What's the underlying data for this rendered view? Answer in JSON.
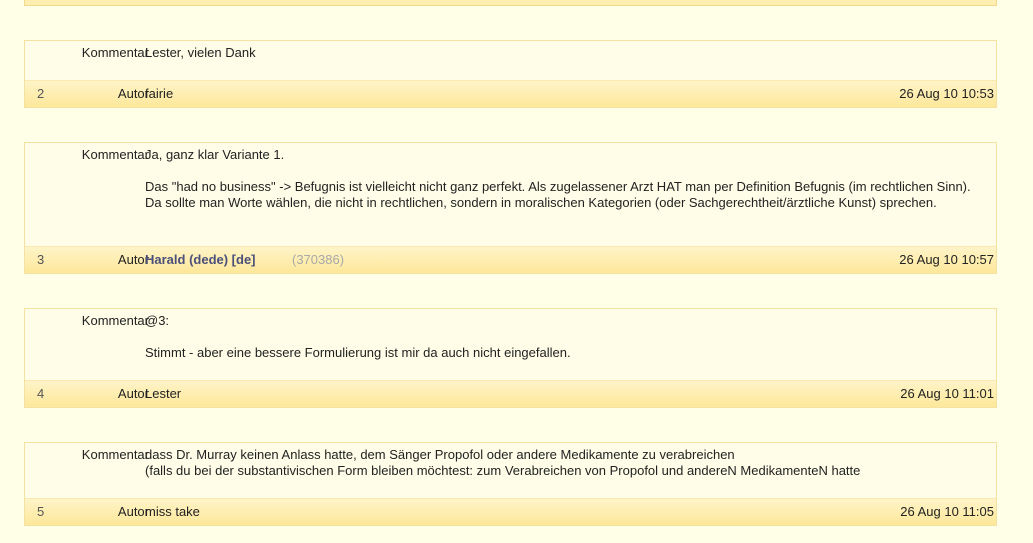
{
  "labels": {
    "comment": "Kommentar",
    "author": "Autor"
  },
  "posts": [
    {
      "number": "2",
      "comment_lines": [
        "Lester, vielen Dank"
      ],
      "author": "fairie",
      "author_id": "",
      "date": "26 Aug 10 10:53"
    },
    {
      "number": "3",
      "comment_lines": [
        "Ja, ganz klar Variante 1.",
        "Das \"had no business\" -> Befugnis ist vielleicht nicht ganz perfekt. Als zugelassener Arzt HAT man per Definition Befugnis (im rechtlichen Sinn). Da sollte man Worte wählen, die nicht in rechtlichen, sondern in moralischen Kategorien (oder Sachgerechtheit/ärztliche Kunst) sprechen."
      ],
      "author": "Harald (dede) [de]",
      "author_id": "(370386)",
      "date": "26 Aug 10 10:57"
    },
    {
      "number": "4",
      "comment_lines": [
        "@3:",
        "Stimmt - aber eine bessere Formulierung ist mir da auch nicht eingefallen."
      ],
      "author": "Lester",
      "author_id": "",
      "date": "26 Aug 10 11:01"
    },
    {
      "number": "5",
      "comment_lines": [
        "dass Dr. Murray keinen Anlass hatte, dem Sänger Propofol oder andere Medikamente zu verabreichen",
        "(falls du bei der substantivischen Form bleiben möchtest: zum Verabreichen von Propofol und andereN MedikamenteN hatte"
      ],
      "author": "miss take",
      "author_id": "",
      "date": "26 Aug 10 11:05"
    }
  ]
}
